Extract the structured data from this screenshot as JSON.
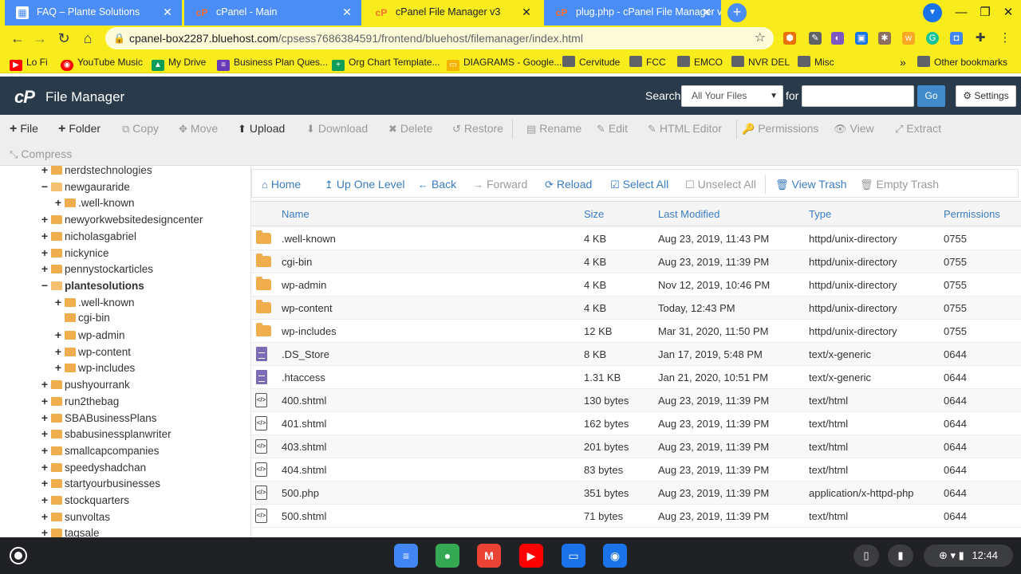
{
  "browser": {
    "tabs": [
      {
        "title": "FAQ – Plante Solutions",
        "icon": "grid-icon",
        "active": false
      },
      {
        "title": "cPanel - Main",
        "icon": "cpanel-icon",
        "active": false
      },
      {
        "title": "cPanel File Manager v3",
        "icon": "cpanel-icon",
        "active": true
      },
      {
        "title": "plug.php - cPanel File Manager v",
        "icon": "cpanel-icon",
        "active": false
      }
    ],
    "url_host": "cpanel-box2287.bluehost.com",
    "url_path": "/cpsess7686384591/frontend/bluehost/filemanager/index.html",
    "bookmarks": [
      {
        "label": "Lo Fi",
        "icon": "youtube-icon"
      },
      {
        "label": "YouTube Music",
        "icon": "youtube-music-icon"
      },
      {
        "label": "My Drive",
        "icon": "drive-icon"
      },
      {
        "label": "Business Plan Ques...",
        "icon": "forms-icon"
      },
      {
        "label": "Org Chart Template...",
        "icon": "sheets-icon"
      },
      {
        "label": "DIAGRAMS - Google...",
        "icon": "slides-icon"
      },
      {
        "label": "Cervitude",
        "icon": "folder-icon"
      },
      {
        "label": "FCC",
        "icon": "folder-icon"
      },
      {
        "label": "EMCO",
        "icon": "folder-icon"
      },
      {
        "label": "NVR DEL",
        "icon": "folder-icon"
      },
      {
        "label": "Misc",
        "icon": "folder-icon"
      }
    ],
    "other_bookmarks": "Other bookmarks",
    "more_bookmarks": "»"
  },
  "header": {
    "title": "File Manager",
    "logo": "cP",
    "search_label": "Search",
    "search_scope": "All Your Files",
    "for_label": "for",
    "search_value": "",
    "go_label": "Go",
    "settings_label": "Settings"
  },
  "actions": [
    {
      "label": "File",
      "icon": "+",
      "enabled": true
    },
    {
      "label": "Folder",
      "icon": "+",
      "enabled": true
    },
    {
      "label": "Copy",
      "icon": "⧉",
      "enabled": false
    },
    {
      "label": "Move",
      "icon": "✥",
      "enabled": false
    },
    {
      "label": "Upload",
      "icon": "⬆",
      "enabled": true
    },
    {
      "label": "Download",
      "icon": "⬇",
      "enabled": false
    },
    {
      "label": "Delete",
      "icon": "✖",
      "enabled": false
    },
    {
      "label": "Restore",
      "icon": "↺",
      "enabled": false
    },
    {
      "label": "Rename",
      "icon": "▤",
      "enabled": false
    },
    {
      "label": "Edit",
      "icon": "✎",
      "enabled": false
    },
    {
      "label": "HTML Editor",
      "icon": "✎",
      "enabled": false
    },
    {
      "label": "Permissions",
      "icon": "🔑",
      "enabled": false
    },
    {
      "label": "View",
      "icon": "👁",
      "enabled": false
    },
    {
      "label": "Extract",
      "icon": "⤢",
      "enabled": false
    },
    {
      "label": "Compress",
      "icon": "⤡",
      "enabled": false
    }
  ],
  "tree": [
    {
      "label": "nerdstechnologies",
      "toggle": "+",
      "depth": 0,
      "open": false,
      "bold": false
    },
    {
      "label": "newgauraride",
      "toggle": "−",
      "depth": 0,
      "open": true,
      "bold": false
    },
    {
      "label": ".well-known",
      "toggle": "+",
      "depth": 1,
      "open": false,
      "bold": false
    },
    {
      "label": "newyorkwebsitedesigncenter",
      "toggle": "+",
      "depth": 0,
      "open": false,
      "bold": false
    },
    {
      "label": "nicholasgabriel",
      "toggle": "+",
      "depth": 0,
      "open": false,
      "bold": false
    },
    {
      "label": "nickynice",
      "toggle": "+",
      "depth": 0,
      "open": false,
      "bold": false
    },
    {
      "label": "pennystockarticles",
      "toggle": "+",
      "depth": 0,
      "open": false,
      "bold": false
    },
    {
      "label": "plantesolutions",
      "toggle": "−",
      "depth": 0,
      "open": true,
      "bold": true
    },
    {
      "label": ".well-known",
      "toggle": "+",
      "depth": 1,
      "open": false,
      "bold": false
    },
    {
      "label": "cgi-bin",
      "toggle": "",
      "depth": 1,
      "open": false,
      "bold": false
    },
    {
      "label": "wp-admin",
      "toggle": "+",
      "depth": 1,
      "open": false,
      "bold": false
    },
    {
      "label": "wp-content",
      "toggle": "+",
      "depth": 1,
      "open": false,
      "bold": false
    },
    {
      "label": "wp-includes",
      "toggle": "+",
      "depth": 1,
      "open": false,
      "bold": false
    },
    {
      "label": "pushyourrank",
      "toggle": "+",
      "depth": 0,
      "open": false,
      "bold": false
    },
    {
      "label": "run2thebag",
      "toggle": "+",
      "depth": 0,
      "open": false,
      "bold": false
    },
    {
      "label": "SBABusinessPlans",
      "toggle": "+",
      "depth": 0,
      "open": false,
      "bold": false
    },
    {
      "label": "sbabusinessplanwriter",
      "toggle": "+",
      "depth": 0,
      "open": false,
      "bold": false
    },
    {
      "label": "smallcapcompanies",
      "toggle": "+",
      "depth": 0,
      "open": false,
      "bold": false
    },
    {
      "label": "speedyshadchan",
      "toggle": "+",
      "depth": 0,
      "open": false,
      "bold": false
    },
    {
      "label": "startyourbusinesses",
      "toggle": "+",
      "depth": 0,
      "open": false,
      "bold": false
    },
    {
      "label": "stockquarters",
      "toggle": "+",
      "depth": 0,
      "open": false,
      "bold": false
    },
    {
      "label": "sunvoltas",
      "toggle": "+",
      "depth": 0,
      "open": false,
      "bold": false
    },
    {
      "label": "tagsale",
      "toggle": "+",
      "depth": 0,
      "open": false,
      "bold": false
    }
  ],
  "navstrip": [
    {
      "label": "Home",
      "icon": "⌂",
      "enabled": true
    },
    {
      "label": "Up One Level",
      "icon": "↥",
      "enabled": true
    },
    {
      "label": "Back",
      "icon": "←",
      "enabled": true
    },
    {
      "label": "Forward",
      "icon": "→",
      "enabled": false
    },
    {
      "label": "Reload",
      "icon": "⟳",
      "enabled": true
    },
    {
      "label": "Select All",
      "icon": "☑",
      "enabled": true
    },
    {
      "label": "Unselect All",
      "icon": "☐",
      "enabled": false
    },
    {
      "label": "View Trash",
      "icon": "🗑",
      "enabled": true
    },
    {
      "label": "Empty Trash",
      "icon": "🗑",
      "enabled": false
    }
  ],
  "columns": {
    "name": "Name",
    "size": "Size",
    "modified": "Last Modified",
    "type": "Type",
    "perms": "Permissions"
  },
  "files": [
    {
      "kind": "dir",
      "name": ".well-known",
      "size": "4 KB",
      "modified": "Aug 23, 2019, 11:43 PM",
      "type": "httpd/unix-directory",
      "perms": "0755"
    },
    {
      "kind": "dir",
      "name": "cgi-bin",
      "size": "4 KB",
      "modified": "Aug 23, 2019, 11:39 PM",
      "type": "httpd/unix-directory",
      "perms": "0755"
    },
    {
      "kind": "dir",
      "name": "wp-admin",
      "size": "4 KB",
      "modified": "Nov 12, 2019, 10:46 PM",
      "type": "httpd/unix-directory",
      "perms": "0755"
    },
    {
      "kind": "dir",
      "name": "wp-content",
      "size": "4 KB",
      "modified": "Today, 12:43 PM",
      "type": "httpd/unix-directory",
      "perms": "0755"
    },
    {
      "kind": "dir",
      "name": "wp-includes",
      "size": "12 KB",
      "modified": "Mar 31, 2020, 11:50 PM",
      "type": "httpd/unix-directory",
      "perms": "0755"
    },
    {
      "kind": "file",
      "name": ".DS_Store",
      "size": "8 KB",
      "modified": "Jan 17, 2019, 5:48 PM",
      "type": "text/x-generic",
      "perms": "0644"
    },
    {
      "kind": "file",
      "name": ".htaccess",
      "size": "1.31 KB",
      "modified": "Jan 21, 2020, 10:51 PM",
      "type": "text/x-generic",
      "perms": "0644"
    },
    {
      "kind": "html",
      "name": "400.shtml",
      "size": "130 bytes",
      "modified": "Aug 23, 2019, 11:39 PM",
      "type": "text/html",
      "perms": "0644"
    },
    {
      "kind": "html",
      "name": "401.shtml",
      "size": "162 bytes",
      "modified": "Aug 23, 2019, 11:39 PM",
      "type": "text/html",
      "perms": "0644"
    },
    {
      "kind": "html",
      "name": "403.shtml",
      "size": "201 bytes",
      "modified": "Aug 23, 2019, 11:39 PM",
      "type": "text/html",
      "perms": "0644"
    },
    {
      "kind": "html",
      "name": "404.shtml",
      "size": "83 bytes",
      "modified": "Aug 23, 2019, 11:39 PM",
      "type": "text/html",
      "perms": "0644"
    },
    {
      "kind": "html",
      "name": "500.php",
      "size": "351 bytes",
      "modified": "Aug 23, 2019, 11:39 PM",
      "type": "application/x-httpd-php",
      "perms": "0644"
    },
    {
      "kind": "html",
      "name": "500.shtml",
      "size": "71 bytes",
      "modified": "Aug 23, 2019, 11:39 PM",
      "type": "text/html",
      "perms": "0644"
    }
  ],
  "shelf": {
    "apps": [
      {
        "name": "docs-icon",
        "glyph": "≡",
        "color": "#4285f4"
      },
      {
        "name": "chrome-icon",
        "glyph": "●",
        "color": "#34a853"
      },
      {
        "name": "gmail-icon",
        "glyph": "M",
        "color": "#ea4335"
      },
      {
        "name": "youtube-icon",
        "glyph": "▶",
        "color": "#ff0000"
      },
      {
        "name": "files-icon",
        "glyph": "▭",
        "color": "#1a73e8"
      },
      {
        "name": "screencast-icon",
        "glyph": "◉",
        "color": "#1a73e8"
      }
    ],
    "clock": "12:44"
  },
  "colors": {
    "chrome_yellow": "#f9ec1c",
    "tab_blue": "#4a8df6",
    "cpanel_header": "#293a4a",
    "link_blue": "#3a7cc0",
    "folder": "#f0ad4e"
  }
}
